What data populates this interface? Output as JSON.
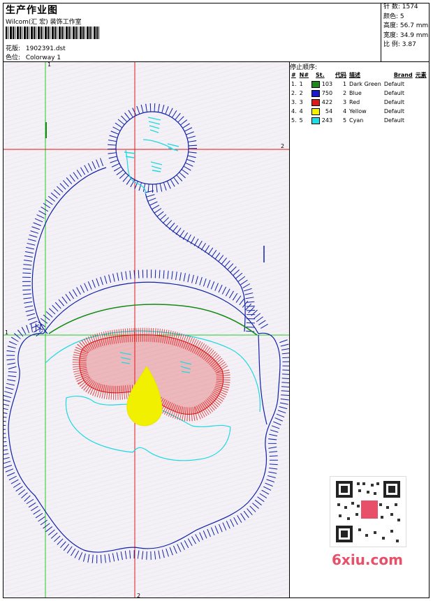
{
  "header": {
    "title": "生产作业图",
    "subtitle": "Wilcom(汇 宏) 装饰工作室",
    "design_label": "花版:",
    "design_value": "1902391.dst",
    "colorway_label": "色位:",
    "colorway_value": "Colorway 1"
  },
  "stats": {
    "stitches": "针 数: 1574",
    "colors": "颜色: 5",
    "height": "高度: 56.7 mm",
    "width": "宽度: 34.9 mm",
    "ratio": "比 例: 3.87"
  },
  "axes": {
    "v1_top": "1",
    "h1_left": "1",
    "h2_right": "2",
    "v2_bottom": "2"
  },
  "stop_sequence": {
    "title": "停止顺序:",
    "headers": [
      "#",
      "N#",
      "St.",
      "代码",
      "描述",
      "Brand",
      "元素"
    ],
    "rows": [
      {
        "n": "1.",
        "nn": "1",
        "color": "#1a8a1a",
        "st": "103",
        "code": "1",
        "desc": "Dark Green",
        "brand": "Default"
      },
      {
        "n": "2.",
        "nn": "2",
        "color": "#1a1acc",
        "st": "750",
        "code": "2",
        "desc": "Blue",
        "brand": "Default"
      },
      {
        "n": "3.",
        "nn": "3",
        "color": "#e01818",
        "st": "422",
        "code": "3",
        "desc": "Red",
        "brand": "Default"
      },
      {
        "n": "4.",
        "nn": "4",
        "color": "#f2f200",
        "st": "54",
        "code": "4",
        "desc": "Yellow",
        "brand": "Default"
      },
      {
        "n": "5.",
        "nn": "5",
        "color": "#18e0e8",
        "st": "243",
        "code": "5",
        "desc": "Cyan",
        "brand": "Default"
      }
    ]
  },
  "watermark": "6xiu.com",
  "colors": {
    "blue": "#1020a8",
    "green": "#148a14",
    "red": "#d81010",
    "yellow": "#f0f000",
    "cyan": "#20d8e0",
    "guide_red": "#e01818",
    "guide_green": "#22cc22"
  }
}
